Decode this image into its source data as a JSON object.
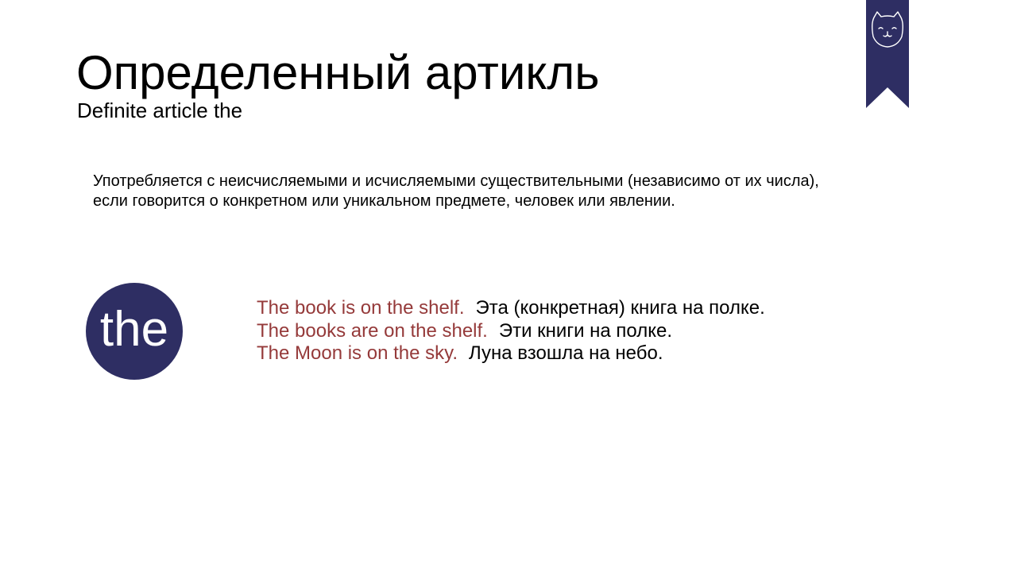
{
  "slide": {
    "title": "Определенный артикль",
    "subtitle": "Definite article the",
    "bookmark_icon": "cat-face-icon",
    "description": [
      "Употребляется с неисчисляемыми и исчисляемыми существительными (независимо от их числа),",
      "если говорится о конкретном или уникальном предмете, человек или явлении."
    ],
    "badge_text": "the",
    "examples": [
      {
        "en": "The book is on the shelf.",
        "ru": "Эта (конкретная) книга на полке."
      },
      {
        "en": "The books are on the shelf.",
        "ru": "Эти книги на полке."
      },
      {
        "en": "The Moon is on the sky.",
        "ru": "Луна взошла на небо."
      }
    ]
  },
  "colors": {
    "accent_navy": "#2e2e63",
    "example_red": "#953a3a",
    "text": "#000000",
    "background": "#ffffff"
  }
}
